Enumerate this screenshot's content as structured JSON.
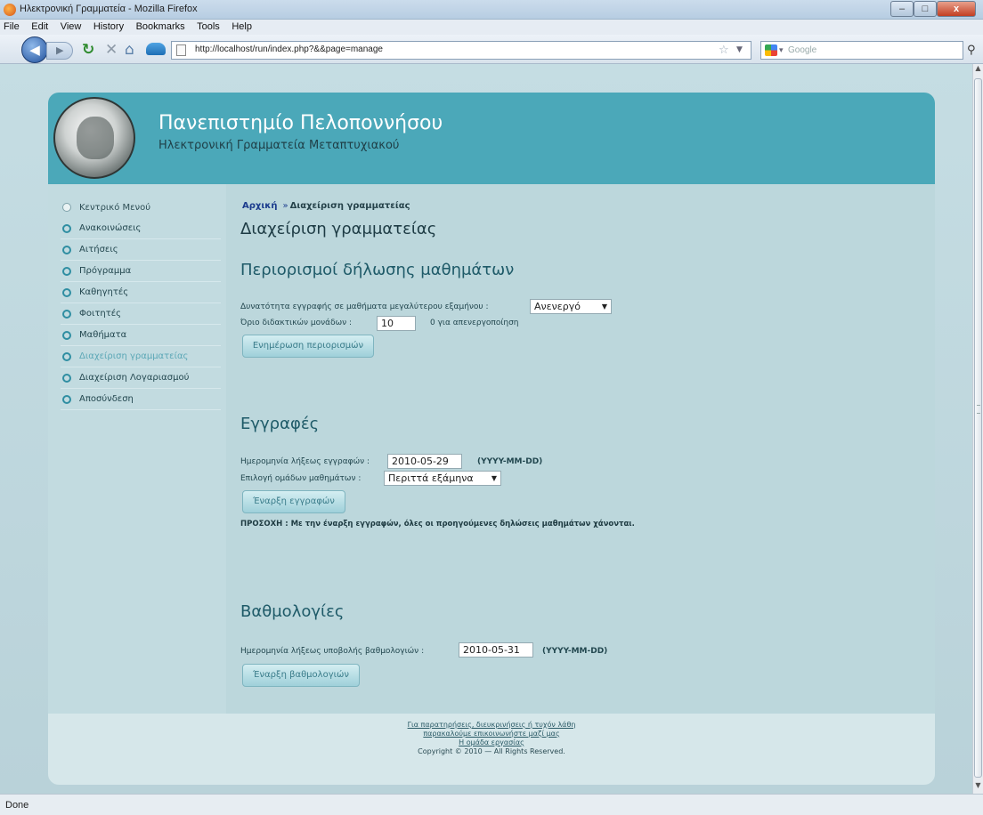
{
  "window": {
    "title": "Ηλεκτρονική Γραμματεία - Mozilla Firefox",
    "minimize": "–",
    "maximize": "□",
    "close": "x"
  },
  "menu": [
    "File",
    "Edit",
    "View",
    "History",
    "Bookmarks",
    "Tools",
    "Help"
  ],
  "nav": {
    "url": "http://localhost/run/index.php?&&page=manage",
    "search_placeholder": "Google"
  },
  "header": {
    "title": "Πανεπιστημίο Πελοποννήσου",
    "subtitle": "Ηλεκτρονική Γραμματεία Μεταπτυχιακού"
  },
  "sidebar": {
    "items": [
      {
        "label": "Κεντρικό Μενού"
      },
      {
        "label": "Ανακοινώσεις"
      },
      {
        "label": "Αιτήσεις"
      },
      {
        "label": "Πρόγραμμα"
      },
      {
        "label": "Καθηγητές"
      },
      {
        "label": "Φοιτητές"
      },
      {
        "label": "Μαθήματα"
      },
      {
        "label": "Διαχείριση γραμματείας"
      },
      {
        "label": "Διαχείριση Λογαριασμού"
      },
      {
        "label": "Αποσύνδεση"
      }
    ]
  },
  "breadcrumb": {
    "home": "Αρχική",
    "separator": "»",
    "current": "Διαχείριση γραμματείας"
  },
  "page_title": "Διαχείριση γραμματείας",
  "restrictions": {
    "title": "Περιορισμοί δήλωσης μαθημάτων",
    "higher_semester_label": "Δυνατότητα εγγραφής σε μαθήματα μεγαλύτερου εξαμήνου :",
    "higher_semester_value": "Ανενεργό",
    "credit_limit_label": "Όριο διδακτικών μονάδων :",
    "credit_limit_value": "10",
    "credit_limit_hint": "0 για απενεργοποίηση",
    "update_button": "Ενημέρωση περιορισμών"
  },
  "registrations": {
    "title": "Εγγραφές",
    "end_date_label": "Ημερομηνία λήξεως εγγραφών :",
    "end_date_value": "2010-05-29",
    "date_format": "(YYYY-MM-DD)",
    "semester_group_label": "Επιλογή ομάδων μαθημάτων :",
    "semester_group_value": "Περιττά εξάμηνα",
    "start_button": "Έναρξη εγγραφών",
    "warning": "ΠΡΟΣΟΧΗ : Με την έναρξη εγγραφών, όλες οι προηγούμενες δηλώσεις μαθημάτων χάνονται."
  },
  "grades": {
    "title": "Βαθμολογίες",
    "end_date_label": "Ημερομηνία λήξεως υποβολής βαθμολογιών :",
    "end_date_value": "2010-05-31",
    "date_format": "(YYYY-MM-DD)",
    "start_button": "Έναρξη βαθμολογιών"
  },
  "footer": {
    "line1": "Για παρατηρήσεις, διευκρινήσεις ή τυχόν λάθη",
    "line2": "παρακαλούμε επικοινωνήστε μαζί μας",
    "line3": "Η ομάδα εργασίας",
    "line4": "Copyright © 2010 — All Rights Reserved."
  },
  "status": "Done",
  "colors": {
    "header": "#4ba8b9",
    "sidebar_bullet": "#2f8ea2",
    "button": "#9fd0da",
    "breadcrumb_link": "#1c3c8e"
  }
}
